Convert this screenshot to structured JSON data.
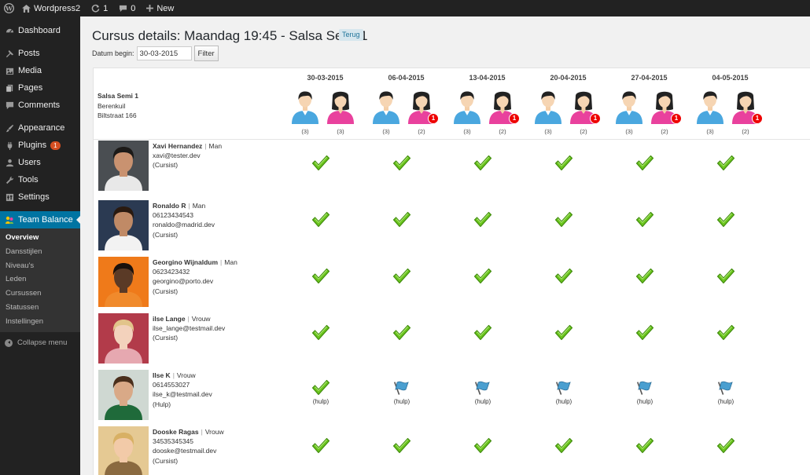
{
  "adminbar": {
    "site_name": "Wordpress2",
    "updates_count": "1",
    "comments_count": "0",
    "new_label": "New"
  },
  "sidebar": {
    "items": [
      {
        "label": "Dashboard",
        "icon": "dashboard-icon"
      },
      {
        "label": "Posts",
        "icon": "pin-icon"
      },
      {
        "label": "Media",
        "icon": "media-icon"
      },
      {
        "label": "Pages",
        "icon": "pages-icon"
      },
      {
        "label": "Comments",
        "icon": "comments-icon"
      },
      {
        "label": "Appearance",
        "icon": "brush-icon"
      },
      {
        "label": "Plugins",
        "icon": "plug-icon",
        "badge": "1"
      },
      {
        "label": "Users",
        "icon": "users-icon"
      },
      {
        "label": "Tools",
        "icon": "wrench-icon"
      },
      {
        "label": "Settings",
        "icon": "settings-icon"
      },
      {
        "label": "Team Balance",
        "icon": "team-balance-icon"
      }
    ],
    "submenu": [
      "Overview",
      "Dansstijlen",
      "Niveau's",
      "Leden",
      "Cursussen",
      "Statussen",
      "Instellingen"
    ],
    "collapse_label": "Collapse menu"
  },
  "page": {
    "title": "Cursus details: Maandag 19:45 - Salsa Semi 1",
    "back_label": "Terug",
    "date_label": "Datum begin:",
    "date_value": "30-03-2015",
    "filter_label": "Filter"
  },
  "course": {
    "name": "Salsa Semi 1",
    "place": "Berenkuil",
    "address": "Biltstraat 166"
  },
  "dates": [
    {
      "date": "30-03-2015",
      "male": "(3)",
      "female": "(3)",
      "notif": ""
    },
    {
      "date": "06-04-2015",
      "male": "(3)",
      "female": "(2)",
      "notif": "1"
    },
    {
      "date": "13-04-2015",
      "male": "(3)",
      "female": "(2)",
      "notif": "1"
    },
    {
      "date": "20-04-2015",
      "male": "(3)",
      "female": "(2)",
      "notif": "1"
    },
    {
      "date": "27-04-2015",
      "male": "(3)",
      "female": "(2)",
      "notif": "1"
    },
    {
      "date": "04-05-2015",
      "male": "(3)",
      "female": "(2)",
      "notif": "1"
    }
  ],
  "members": [
    {
      "name": "Xavi Hernandez",
      "gender": "Man",
      "phone": "",
      "email": "xavi@tester.dev",
      "role": "(Cursist)",
      "photo": "photo-xavi",
      "attendance": [
        "check",
        "check",
        "check",
        "check",
        "check",
        "check"
      ]
    },
    {
      "name": "Ronaldo R",
      "gender": "Man",
      "phone": "06123434543",
      "email": "ronaldo@madrid.dev",
      "role": "(Cursist)",
      "photo": "photo-ronaldo",
      "attendance": [
        "check",
        "check",
        "check",
        "check",
        "check",
        "check"
      ]
    },
    {
      "name": "Georgino Wijnaldum",
      "gender": "Man",
      "phone": "0623423432",
      "email": "georgino@porto.dev",
      "role": "(Cursist)",
      "photo": "photo-georgino",
      "attendance": [
        "check",
        "check",
        "check",
        "check",
        "check",
        "check"
      ]
    },
    {
      "name": "ilse Lange",
      "gender": "Vrouw",
      "phone": "",
      "email": "ilse_lange@testmail.dev",
      "role": "(Cursist)",
      "photo": "photo-ilse-lange",
      "attendance": [
        "check",
        "check",
        "check",
        "check",
        "check",
        "check"
      ]
    },
    {
      "name": "Ilse K",
      "gender": "Vrouw",
      "phone": "0614553027",
      "email": "ilse_k@testmail.dev",
      "role": "(Hulp)",
      "photo": "photo-ilse-k",
      "attendance": [
        "check",
        "flag",
        "flag",
        "flag",
        "flag",
        "flag"
      ],
      "cell_label": "(hulp)"
    },
    {
      "name": "Dooske Ragas",
      "gender": "Vrouw",
      "phone": "34535345345",
      "email": "dooske@testmail.dev",
      "role": "(Cursist)",
      "photo": "photo-dooske",
      "attendance": [
        "check",
        "check",
        "check",
        "check",
        "check",
        "check"
      ]
    }
  ],
  "colors": {
    "admin_dark": "#222222",
    "accent": "#0074a2",
    "check_green": "#5fbf1a",
    "flag_blue": "#4a9fd0",
    "male_blue": "#4aa7df",
    "female_pink": "#e9419d",
    "badge_red": "#e00000"
  }
}
